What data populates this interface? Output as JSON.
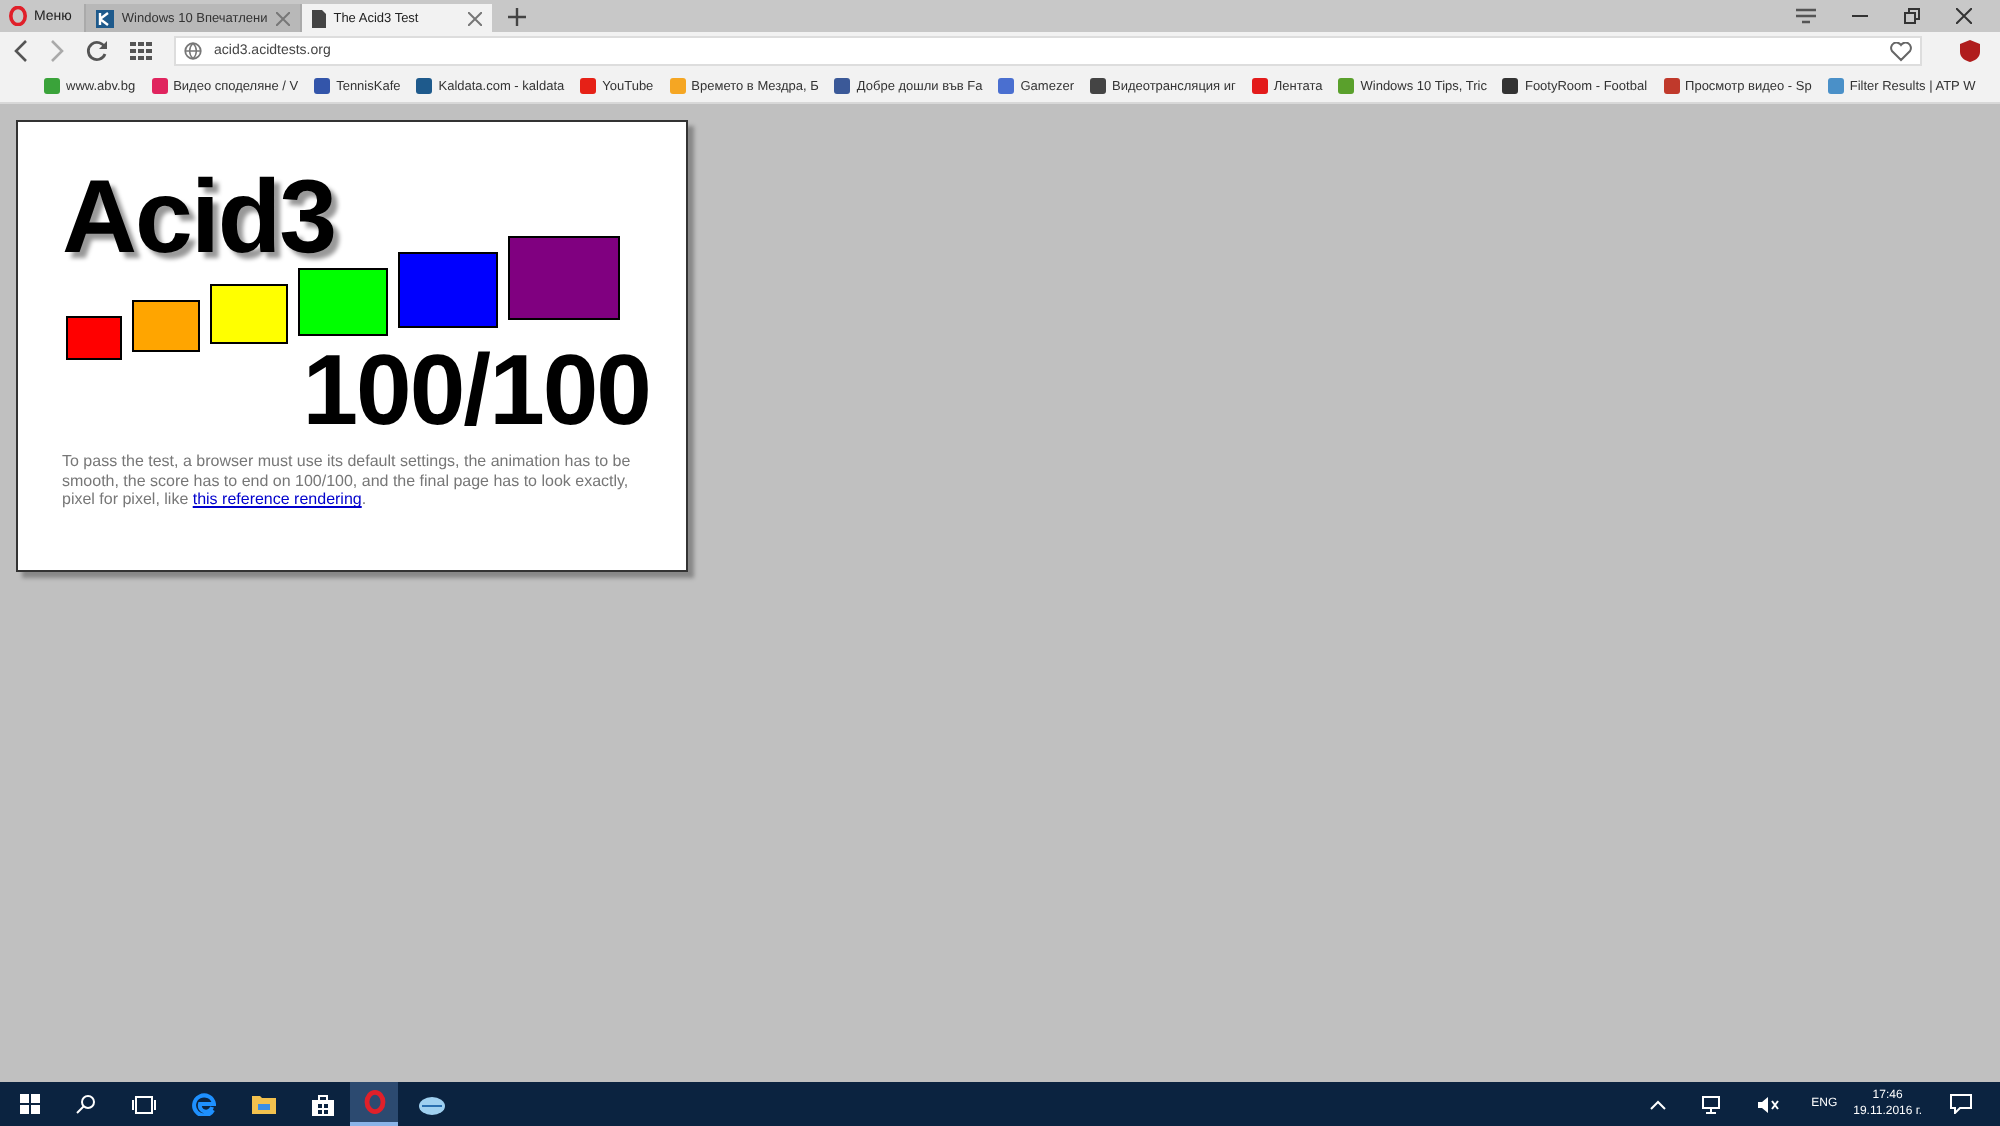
{
  "browser": {
    "menu_label": "Меню",
    "tabs": [
      {
        "title": "Windows 10 Впечатлени",
        "selected": false,
        "kind": "site"
      },
      {
        "title": "The Acid3 Test",
        "selected": true,
        "kind": "page"
      }
    ],
    "address": "acid3.acidtests.org",
    "bookmarks": [
      {
        "label": "www.abv.bg",
        "color": "#3aa33a"
      },
      {
        "label": "Видео споделяне / V",
        "color": "#e0245e"
      },
      {
        "label": "TennisKafe",
        "color": "#3355aa"
      },
      {
        "label": "Kaldata.com - kaldata",
        "color": "#1e5a8c"
      },
      {
        "label": "YouTube",
        "color": "#e62117"
      },
      {
        "label": "Времето в Мездра, Б",
        "color": "#f5a623"
      },
      {
        "label": "Добре дошли във Fa",
        "color": "#3b5998"
      },
      {
        "label": "Gamezer",
        "color": "#4a6fd0"
      },
      {
        "label": "Видеотрансляция иг",
        "color": "#444444"
      },
      {
        "label": "Лентата",
        "color": "#e31b1b"
      },
      {
        "label": "Windows 10 Tips, Tric",
        "color": "#5aa02c"
      },
      {
        "label": "FootyRoom - Footbal",
        "color": "#333333"
      },
      {
        "label": "Просмотр видео - Sp",
        "color": "#c0392b"
      },
      {
        "label": "Filter Results | ATP W",
        "color": "#4a90c8"
      }
    ]
  },
  "page": {
    "title": "Acid3",
    "boxes": [
      {
        "color": "#ff0000"
      },
      {
        "color": "#ffa500"
      },
      {
        "color": "#ffff00"
      },
      {
        "color": "#00ff00"
      },
      {
        "color": "#0000ff"
      },
      {
        "color": "#800080"
      }
    ],
    "score": "100/100",
    "description": "To pass the test, a browser must use its default settings, the animation has to be smooth, the score has to end on 100/100, and the final page has to look exactly, pixel for pixel, like ",
    "link": "this reference rendering",
    "after_link": "."
  },
  "taskbar": {
    "language": "ENG",
    "time": "17:46",
    "date": "19.11.2016 г."
  }
}
